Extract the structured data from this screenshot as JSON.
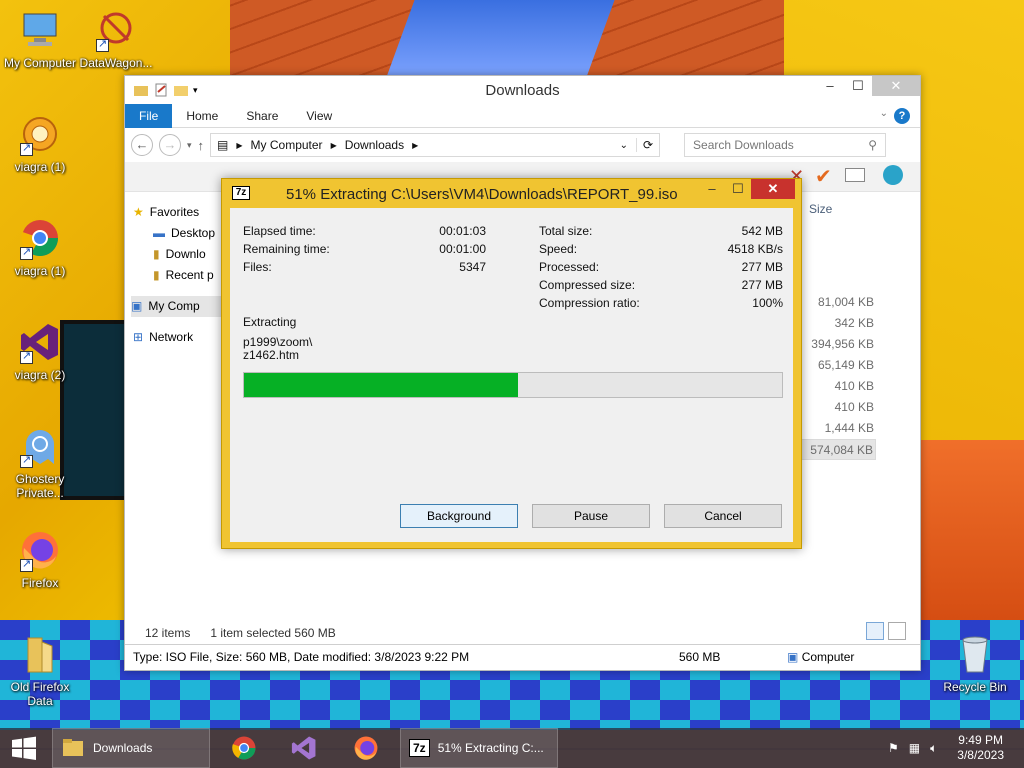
{
  "desktop": {
    "icons": [
      {
        "label": "My Computer"
      },
      {
        "label": "DataWagon..."
      },
      {
        "label": "viagra (1)"
      },
      {
        "label": "viagra (1)"
      },
      {
        "label": "viagra (2)"
      },
      {
        "label": "Ghostery Private..."
      },
      {
        "label": "Firefox"
      },
      {
        "label": "Old Firefox Data"
      },
      {
        "label": "Recycle Bin"
      }
    ]
  },
  "explorer": {
    "title": "Downloads",
    "tabs": [
      "File",
      "Home",
      "Share",
      "View"
    ],
    "address": {
      "root": "My Computer",
      "folder": "Downloads"
    },
    "search_placeholder": "Search Downloads",
    "column_size": "Size",
    "nav": [
      "Favorites",
      "Desktop",
      "Downlo",
      "Recent p",
      "My Comp",
      "Network"
    ],
    "sizes": [
      "81,004 KB",
      "342 KB",
      "394,956 KB",
      "65,149 KB",
      "410 KB",
      "410 KB",
      "1,444 KB",
      "574,084 KB"
    ],
    "status": {
      "items": "12 items",
      "selected": "1 item selected  560 MB"
    },
    "details": {
      "info": "Type: ISO File, Size: 560 MB, Date modified: 3/8/2023 9:22 PM",
      "size": "560 MB",
      "location": "Computer"
    }
  },
  "dialog": {
    "logo": "7z",
    "title": "51% Extracting C:\\Users\\VM4\\Downloads\\REPORT_99.iso",
    "left": [
      {
        "k": "Elapsed time:",
        "v": "00:01:03"
      },
      {
        "k": "Remaining time:",
        "v": "00:01:00"
      },
      {
        "k": "Files:",
        "v": "5347"
      }
    ],
    "right": [
      {
        "k": "Total size:",
        "v": "542 MB"
      },
      {
        "k": "Speed:",
        "v": "4518 KB/s"
      },
      {
        "k": "Processed:",
        "v": "277 MB"
      },
      {
        "k": "Compressed size:",
        "v": "277 MB"
      },
      {
        "k": "Compression ratio:",
        "v": "100%"
      }
    ],
    "extracting_label": "Extracting",
    "current_path": "p1999\\zoom\\",
    "current_file": "z1462.htm",
    "progress_fraction": 0.51,
    "buttons": {
      "background": "Background",
      "pause": "Pause",
      "cancel": "Cancel"
    }
  },
  "taskbar": {
    "explorer_label": "Downloads",
    "sevenzip_label": "51% Extracting C:...",
    "time": "9:49 PM",
    "date": "3/8/2023"
  },
  "colors": {
    "progress_fill": "#06b025",
    "dialog_frame": "#f0c431",
    "ribbon_file": "#1979ca"
  }
}
